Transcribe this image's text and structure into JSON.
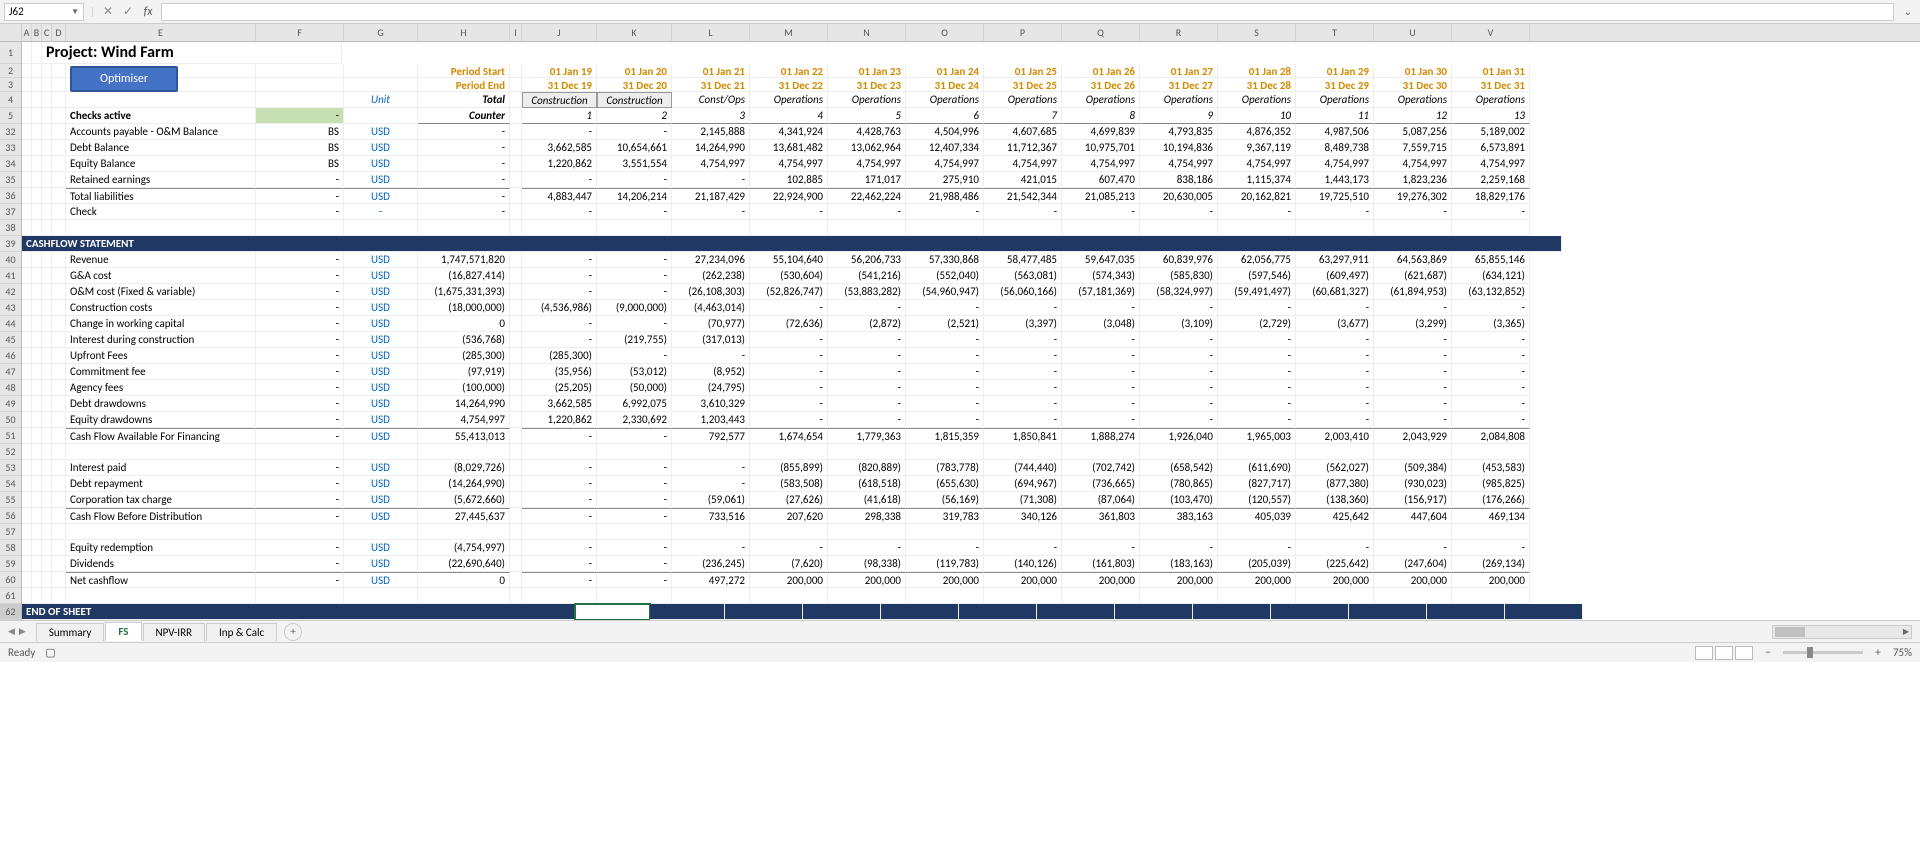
{
  "namebox": "J62",
  "title": "Project: Wind Farm",
  "optimiser": "Optimiser",
  "periodStartLabel": "Period Start",
  "periodEndLabel": "Period End",
  "unitLabel": "Unit",
  "totalLabel": "Total",
  "counterLabel": "Counter",
  "checksActive": "Checks active",
  "greenDash": "-",
  "cols": [
    "A",
    "B",
    "C",
    "D",
    "E",
    "F",
    "G",
    "H",
    "I",
    "J",
    "K",
    "L",
    "M",
    "N",
    "O",
    "P",
    "Q",
    "R",
    "S",
    "T",
    "U",
    "V"
  ],
  "rowNums": [
    "1",
    "2",
    "3",
    "4",
    "5",
    "32",
    "33",
    "34",
    "35",
    "36",
    "37",
    "38",
    "39",
    "40",
    "41",
    "42",
    "43",
    "44",
    "45",
    "46",
    "47",
    "48",
    "49",
    "50",
    "51",
    "52",
    "53",
    "54",
    "55",
    "56",
    "57",
    "58",
    "59",
    "60",
    "61",
    "62"
  ],
  "periodStart": [
    "01 Jan 19",
    "01 Jan 20",
    "01 Jan 21",
    "01 Jan 22",
    "01 Jan 23",
    "01 Jan 24",
    "01 Jan 25",
    "01 Jan 26",
    "01 Jan 27",
    "01 Jan 28",
    "01 Jan 29",
    "01 Jan 30",
    "01 Jan 31"
  ],
  "periodEnd": [
    "31 Dec 19",
    "31 Dec 20",
    "31 Dec 21",
    "31 Dec 22",
    "31 Dec 23",
    "31 Dec 24",
    "31 Dec 25",
    "31 Dec 26",
    "31 Dec 27",
    "31 Dec 28",
    "31 Dec 29",
    "31 Dec 30",
    "31 Dec 31"
  ],
  "phase": [
    "Construction",
    "Construction",
    "Const/Ops",
    "Operations",
    "Operations",
    "Operations",
    "Operations",
    "Operations",
    "Operations",
    "Operations",
    "Operations",
    "Operations",
    "Operations"
  ],
  "counter": [
    "1",
    "2",
    "3",
    "4",
    "5",
    "6",
    "7",
    "8",
    "9",
    "10",
    "11",
    "12",
    "13"
  ],
  "rows": {
    "r32": {
      "label": "Accounts payable - O&M Balance",
      "f": "BS",
      "unit": "USD",
      "total": "-",
      "vals": [
        "-",
        "-",
        "2,145,888",
        "4,341,924",
        "4,428,763",
        "4,504,996",
        "4,607,685",
        "4,699,839",
        "4,793,835",
        "4,876,352",
        "4,987,506",
        "5,087,256",
        "5,189,002"
      ]
    },
    "r33": {
      "label": "Debt Balance",
      "f": "BS",
      "unit": "USD",
      "total": "-",
      "vals": [
        "3,662,585",
        "10,654,661",
        "14,264,990",
        "13,681,482",
        "13,062,964",
        "12,407,334",
        "11,712,367",
        "10,975,701",
        "10,194,836",
        "9,367,119",
        "8,489,738",
        "7,559,715",
        "6,573,891"
      ]
    },
    "r34": {
      "label": "Equity Balance",
      "f": "BS",
      "unit": "USD",
      "total": "-",
      "vals": [
        "1,220,862",
        "3,551,554",
        "4,754,997",
        "4,754,997",
        "4,754,997",
        "4,754,997",
        "4,754,997",
        "4,754,997",
        "4,754,997",
        "4,754,997",
        "4,754,997",
        "4,754,997",
        "4,754,997"
      ]
    },
    "r35": {
      "label": "Retained earnings",
      "f": "-",
      "unit": "USD",
      "total": "-",
      "vals": [
        "-",
        "-",
        "-",
        "102,885",
        "171,017",
        "275,910",
        "421,015",
        "607,470",
        "838,186",
        "1,115,374",
        "1,443,173",
        "1,823,236",
        "2,259,168"
      ]
    },
    "r36": {
      "label": "Total liabilities",
      "f": "-",
      "unit": "USD",
      "total": "-",
      "vals": [
        "4,883,447",
        "14,206,214",
        "21,187,429",
        "22,924,900",
        "22,462,224",
        "21,988,486",
        "21,542,344",
        "21,085,213",
        "20,630,005",
        "20,162,821",
        "19,725,510",
        "19,276,302",
        "18,829,176"
      ]
    },
    "r37": {
      "label": "Check",
      "f": "-",
      "unit": "-",
      "total": "-",
      "vals": [
        "-",
        "-",
        "-",
        "-",
        "-",
        "-",
        "-",
        "-",
        "-",
        "-",
        "-",
        "-",
        "-"
      ]
    },
    "r40": {
      "label": "Revenue",
      "f": "-",
      "unit": "USD",
      "total": "1,747,571,820",
      "vals": [
        "-",
        "-",
        "27,234,096",
        "55,104,640",
        "56,206,733",
        "57,330,868",
        "58,477,485",
        "59,647,035",
        "60,839,976",
        "62,056,775",
        "63,297,911",
        "64,563,869",
        "65,855,146"
      ]
    },
    "r41": {
      "label": "G&A cost",
      "f": "-",
      "unit": "USD",
      "total": "(16,827,414)",
      "vals": [
        "-",
        "-",
        "(262,238)",
        "(530,604)",
        "(541,216)",
        "(552,040)",
        "(563,081)",
        "(574,343)",
        "(585,830)",
        "(597,546)",
        "(609,497)",
        "(621,687)",
        "(634,121)"
      ]
    },
    "r42": {
      "label": "O&M cost (Fixed & variable)",
      "f": "-",
      "unit": "USD",
      "total": "(1,675,331,393)",
      "vals": [
        "-",
        "-",
        "(26,108,303)",
        "(52,826,747)",
        "(53,883,282)",
        "(54,960,947)",
        "(56,060,166)",
        "(57,181,369)",
        "(58,324,997)",
        "(59,491,497)",
        "(60,681,327)",
        "(61,894,953)",
        "(63,132,852)"
      ]
    },
    "r43": {
      "label": "Construction costs",
      "f": "-",
      "unit": "USD",
      "total": "(18,000,000)",
      "vals": [
        "(4,536,986)",
        "(9,000,000)",
        "(4,463,014)",
        "-",
        "-",
        "-",
        "-",
        "-",
        "-",
        "-",
        "-",
        "-",
        "-"
      ]
    },
    "r44": {
      "label": "Change in working capital",
      "f": "-",
      "unit": "USD",
      "total": "0",
      "vals": [
        "-",
        "-",
        "(70,977)",
        "(72,636)",
        "(2,872)",
        "(2,521)",
        "(3,397)",
        "(3,048)",
        "(3,109)",
        "(2,729)",
        "(3,677)",
        "(3,299)",
        "(3,365)"
      ]
    },
    "r45": {
      "label": "Interest during construction",
      "f": "-",
      "unit": "USD",
      "total": "(536,768)",
      "vals": [
        "-",
        "(219,755)",
        "(317,013)",
        "-",
        "-",
        "-",
        "-",
        "-",
        "-",
        "-",
        "-",
        "-",
        "-"
      ]
    },
    "r46": {
      "label": "Upfront Fees",
      "f": "-",
      "unit": "USD",
      "total": "(285,300)",
      "vals": [
        "(285,300)",
        "-",
        "-",
        "-",
        "-",
        "-",
        "-",
        "-",
        "-",
        "-",
        "-",
        "-",
        "-"
      ]
    },
    "r47": {
      "label": "Commitment fee",
      "f": "-",
      "unit": "USD",
      "total": "(97,919)",
      "vals": [
        "(35,956)",
        "(53,012)",
        "(8,952)",
        "-",
        "-",
        "-",
        "-",
        "-",
        "-",
        "-",
        "-",
        "-",
        "-"
      ]
    },
    "r48": {
      "label": "Agency fees",
      "f": "-",
      "unit": "USD",
      "total": "(100,000)",
      "vals": [
        "(25,205)",
        "(50,000)",
        "(24,795)",
        "-",
        "-",
        "-",
        "-",
        "-",
        "-",
        "-",
        "-",
        "-",
        "-"
      ]
    },
    "r49": {
      "label": "Debt drawdowns",
      "f": "-",
      "unit": "USD",
      "total": "14,264,990",
      "vals": [
        "3,662,585",
        "6,992,075",
        "3,610,329",
        "-",
        "-",
        "-",
        "-",
        "-",
        "-",
        "-",
        "-",
        "-",
        "-"
      ]
    },
    "r50": {
      "label": "Equity drawdowns",
      "f": "-",
      "unit": "USD",
      "total": "4,754,997",
      "vals": [
        "1,220,862",
        "2,330,692",
        "1,203,443",
        "-",
        "-",
        "-",
        "-",
        "-",
        "-",
        "-",
        "-",
        "-",
        "-"
      ]
    },
    "r51": {
      "label": "Cash Flow Available For Financing",
      "f": "-",
      "unit": "USD",
      "total": "55,413,013",
      "vals": [
        "-",
        "-",
        "792,577",
        "1,674,654",
        "1,779,363",
        "1,815,359",
        "1,850,841",
        "1,888,274",
        "1,926,040",
        "1,965,003",
        "2,003,410",
        "2,043,929",
        "2,084,808"
      ]
    },
    "r53": {
      "label": "Interest paid",
      "f": "-",
      "unit": "USD",
      "total": "(8,029,726)",
      "vals": [
        "-",
        "-",
        "-",
        "(855,899)",
        "(820,889)",
        "(783,778)",
        "(744,440)",
        "(702,742)",
        "(658,542)",
        "(611,690)",
        "(562,027)",
        "(509,384)",
        "(453,583)"
      ]
    },
    "r54": {
      "label": "Debt repayment",
      "f": "-",
      "unit": "USD",
      "total": "(14,264,990)",
      "vals": [
        "-",
        "-",
        "-",
        "(583,508)",
        "(618,518)",
        "(655,630)",
        "(694,967)",
        "(736,665)",
        "(780,865)",
        "(827,717)",
        "(877,380)",
        "(930,023)",
        "(985,825)"
      ]
    },
    "r55": {
      "label": "Corporation tax charge",
      "f": "-",
      "unit": "USD",
      "total": "(5,672,660)",
      "vals": [
        "-",
        "-",
        "(59,061)",
        "(27,626)",
        "(41,618)",
        "(56,169)",
        "(71,308)",
        "(87,064)",
        "(103,470)",
        "(120,557)",
        "(138,360)",
        "(156,917)",
        "(176,266)"
      ]
    },
    "r56": {
      "label": "Cash Flow Before Distribution",
      "f": "-",
      "unit": "USD",
      "total": "27,445,637",
      "vals": [
        "-",
        "-",
        "733,516",
        "207,620",
        "298,338",
        "319,783",
        "340,126",
        "361,803",
        "383,163",
        "405,039",
        "425,642",
        "447,604",
        "469,134"
      ]
    },
    "r58": {
      "label": "Equity redemption",
      "f": "-",
      "unit": "USD",
      "total": "(4,754,997)",
      "vals": [
        "-",
        "-",
        "-",
        "-",
        "-",
        "-",
        "-",
        "-",
        "-",
        "-",
        "-",
        "-",
        "-"
      ]
    },
    "r59": {
      "label": "Dividends",
      "f": "-",
      "unit": "USD",
      "total": "(22,690,640)",
      "vals": [
        "-",
        "-",
        "(236,245)",
        "(7,620)",
        "(98,338)",
        "(119,783)",
        "(140,126)",
        "(161,803)",
        "(183,163)",
        "(205,039)",
        "(225,642)",
        "(247,604)",
        "(269,134)"
      ]
    },
    "r60": {
      "label": "Net cashflow",
      "f": "-",
      "unit": "USD",
      "total": "0",
      "vals": [
        "-",
        "-",
        "497,272",
        "200,000",
        "200,000",
        "200,000",
        "200,000",
        "200,000",
        "200,000",
        "200,000",
        "200,000",
        "200,000",
        "200,000"
      ]
    }
  },
  "sectionCashflow": "CASHFLOW STATEMENT",
  "endOfSheet": "END OF SHEET",
  "tabs": [
    "Summary",
    "FS",
    "NPV-IRR",
    "Inp & Calc"
  ],
  "activeTab": "FS",
  "status": "Ready",
  "zoom": "75%"
}
